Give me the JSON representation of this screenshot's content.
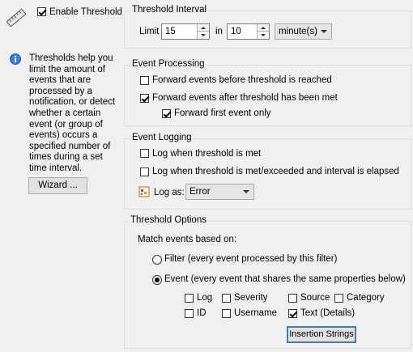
{
  "left": {
    "enable_threshold_label": "Enable Threshold",
    "enable_threshold_checked": true,
    "info_text": "Thresholds help you limit the amount of events that are processed by a notification, or detect whether a certain event (or group of events) occurs a specified number of times during a set time interval.",
    "info_lines": [
      "Thresholds help you",
      "limit the amount of",
      "events that are",
      "processed by a",
      "notification, or detect",
      "whether a certain",
      "event (or group of",
      "events) occurs a",
      "specified number of",
      "times during a set",
      "time interval."
    ],
    "wizard_button": "Wizard ..."
  },
  "interval": {
    "title": "Threshold Interval",
    "limit_label": "Limit",
    "limit_value": "15",
    "in_label": "in",
    "in_value": "10",
    "unit_value": "minute(s)"
  },
  "processing": {
    "title": "Event Processing",
    "before_label": "Forward events before threshold is reached",
    "before_checked": false,
    "after_label": "Forward events after threshold has been met",
    "after_checked": true,
    "first_only_label": "Forward first event only",
    "first_only_checked": true
  },
  "logging": {
    "title": "Event Logging",
    "met_label": "Log when threshold is met",
    "met_checked": false,
    "exceeded_label": "Log when threshold is met/exceeded and interval is elapsed",
    "exceeded_checked": false,
    "log_as_label": "Log as:",
    "log_as_value": "Error"
  },
  "options": {
    "title": "Threshold Options",
    "match_label": "Match events based on:",
    "filter_radio": "Filter (every event processed by this filter)",
    "event_radio": "Event (every event that shares the same properties below)",
    "selected": "event",
    "props": {
      "log": {
        "label": "Log",
        "checked": false
      },
      "severity": {
        "label": "Severity",
        "checked": false
      },
      "source": {
        "label": "Source",
        "checked": false
      },
      "category": {
        "label": "Category",
        "checked": false
      },
      "id": {
        "label": "ID",
        "checked": false
      },
      "username": {
        "label": "Username",
        "checked": false
      },
      "text": {
        "label": "Text (Details)",
        "checked": true
      }
    },
    "insertion_button": "Insertion Strings"
  }
}
